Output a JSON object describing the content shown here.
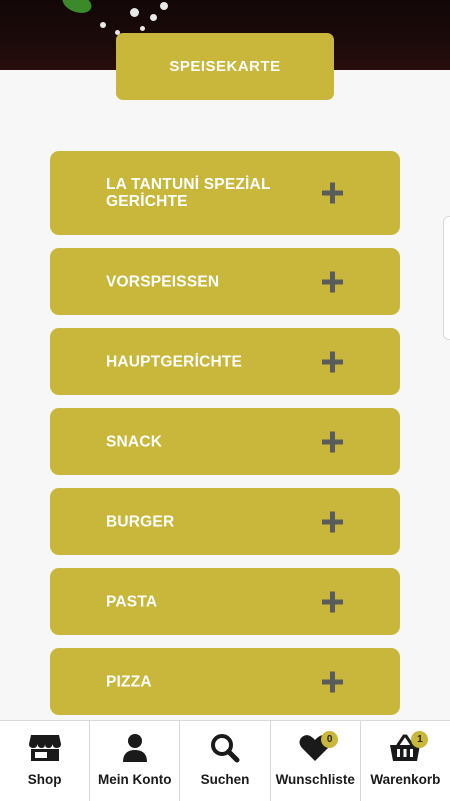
{
  "header": {
    "menu_title": "SPEISEKARTE"
  },
  "categories": [
    {
      "label": "LA TANTUNİ SPEZİAL GERİCHTE",
      "icon": "plus-icon"
    },
    {
      "label": "VORSPEISSEN",
      "icon": "plus-icon"
    },
    {
      "label": "HAUPTGERİCHTE",
      "icon": "plus-icon"
    },
    {
      "label": "SNACK",
      "icon": "plus-icon"
    },
    {
      "label": "BURGER",
      "icon": "plus-icon"
    },
    {
      "label": "PASTA",
      "icon": "plus-icon"
    },
    {
      "label": "PIZZA",
      "icon": "plus-icon"
    }
  ],
  "bottom_nav": {
    "items": [
      {
        "label": "Shop",
        "icon": "store-icon"
      },
      {
        "label": "Mein Konto",
        "icon": "user-icon"
      },
      {
        "label": "Suchen",
        "icon": "search-icon"
      },
      {
        "label": "Wunschliste",
        "icon": "heart-icon",
        "badge": "0"
      },
      {
        "label": "Warenkorb",
        "icon": "cart-icon",
        "badge": "1"
      }
    ]
  },
  "colors": {
    "accent": "#c8b73a",
    "plus": "#5b5b5b",
    "background": "#f7f7f7"
  }
}
